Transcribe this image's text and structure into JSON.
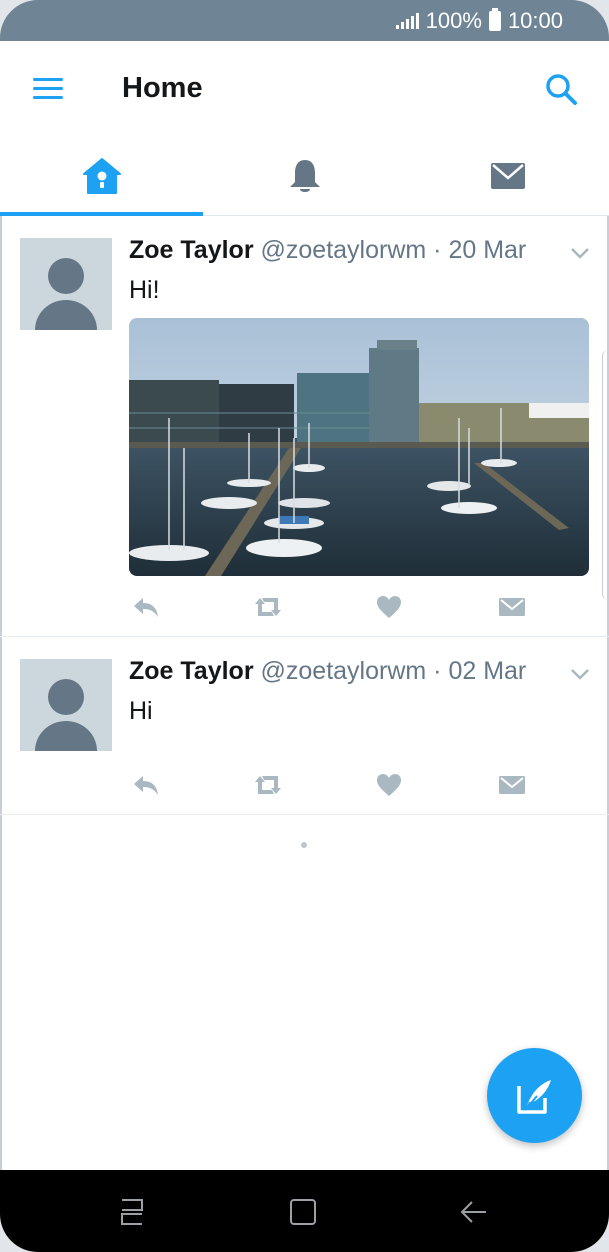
{
  "status_bar": {
    "battery": "100%",
    "time": "10:00"
  },
  "app_bar": {
    "title": "Home",
    "menu_icon": "hamburger-icon",
    "search_icon": "search-icon"
  },
  "tabs": [
    {
      "name": "home",
      "icon": "home-icon",
      "active": true
    },
    {
      "name": "notifications",
      "icon": "bell-icon",
      "active": false
    },
    {
      "name": "messages",
      "icon": "envelope-icon",
      "active": false
    }
  ],
  "tweets": [
    {
      "name": "Zoe Taylor",
      "handle": "@zoetaylorwm",
      "date": "· 20 Mar",
      "text": "Hi!",
      "has_media": true,
      "media_icon": "marina-photo"
    },
    {
      "name": "Zoe Taylor",
      "handle": "@zoetaylorwm",
      "date": "· 02 Mar",
      "text": "Hi",
      "has_media": false
    }
  ],
  "action_icons": [
    "reply-icon",
    "retweet-icon",
    "like-icon",
    "direct-message-icon"
  ],
  "fab": {
    "icon": "compose-tweet-icon"
  },
  "nav_bar": {
    "icons": [
      "recents-icon",
      "home-icon",
      "back-icon"
    ]
  },
  "colors": {
    "accent": "#1da1f2",
    "status_bar": "#6f8595",
    "icon_gray": "#657786",
    "action_gray": "#aab8c2"
  }
}
